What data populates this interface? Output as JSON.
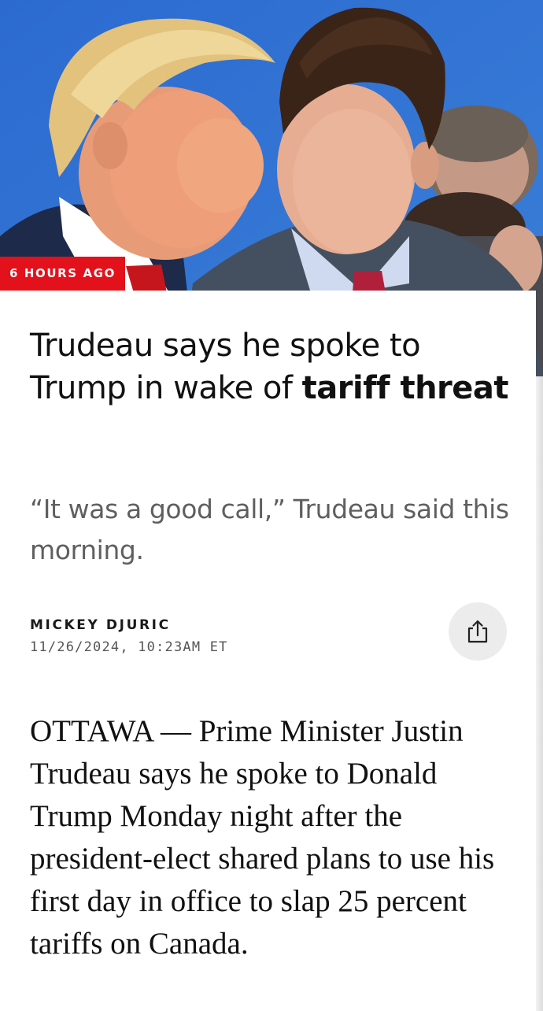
{
  "hero": {
    "time_badge": "6 HOURS AGO"
  },
  "article": {
    "headline_regular": "Trudeau says he spoke to Trump in wake of ",
    "headline_bold": "tariff threat",
    "subhead": "“It was a good call,” Trudeau said this morning.",
    "author": "MICKEY DJURIC",
    "timestamp": "11/26/2024, 10:23AM ET",
    "share_icon": "share-icon",
    "body": "OTTAWA — Prime Minister Justin Trudeau says he spoke to Donald Trump Monday night after the president-elect shared plans to use his first day in office to slap 25 percent tariffs on Canada."
  },
  "colors": {
    "badge": "#e3111b",
    "hero_background": "#2f6fd0",
    "headline": "#111111",
    "subhead": "#5f5f5f"
  }
}
